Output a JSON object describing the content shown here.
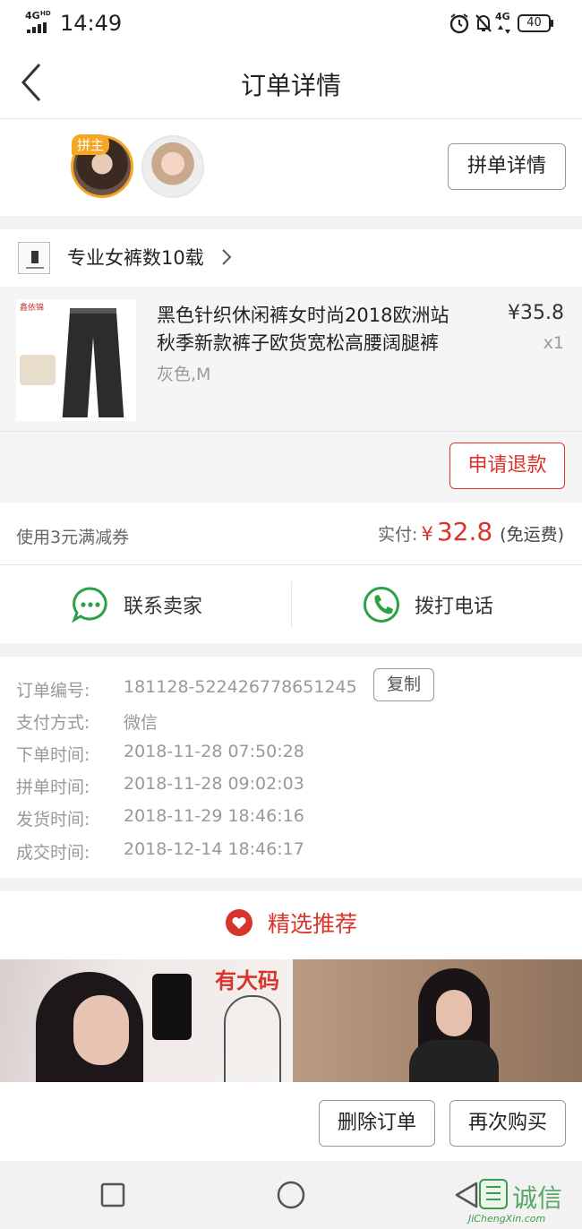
{
  "status_bar": {
    "network": "4G",
    "network_sup": "HD",
    "time": "14:49",
    "sig2": "4G",
    "battery": "40"
  },
  "header": {
    "title": "订单详情"
  },
  "group": {
    "leader_badge": "拼主",
    "details_button": "拼单详情"
  },
  "shop": {
    "name": "专业女裤数10载"
  },
  "product": {
    "title_line1": "黑色针织休闲裤女时尚2018欧洲站",
    "title_line2": "秋季新款裤子欧货宽松高腰阔腿裤",
    "spec": "灰色,M",
    "price": "¥35.8",
    "qty": "x1",
    "thumb_brand": "鑫依锦"
  },
  "refund_button": "申请退款",
  "summary": {
    "coupon": "使用3元满减券",
    "paid_label": "实付:",
    "currency": "¥",
    "paid_amount": "32.8",
    "shipping": "(免运费)"
  },
  "contact": {
    "seller": "联系卖家",
    "call": "拨打电话"
  },
  "order_info": {
    "copy_button": "复制",
    "rows": [
      {
        "label": "订单编号:",
        "value": "181128-522426778651245"
      },
      {
        "label": "支付方式:",
        "value": "微信"
      },
      {
        "label": "下单时间:",
        "value": "2018-11-28 07:50:28"
      },
      {
        "label": "拼单时间:",
        "value": "2018-11-28 09:02:03"
      },
      {
        "label": "发货时间:",
        "value": "2018-11-29 18:46:16"
      },
      {
        "label": "成交时间:",
        "value": "2018-12-14 18:46:17"
      }
    ]
  },
  "recommend": {
    "title": "精选推荐",
    "card1_tag": "有大码"
  },
  "actions": {
    "delete": "删除订单",
    "rebuy": "再次购买"
  },
  "watermark": {
    "text": "诚信",
    "url": "JiChengXin.com"
  },
  "colors": {
    "accent_red": "#d9342b",
    "wechat_green": "#2ba245",
    "badge_orange": "#f5a623"
  }
}
